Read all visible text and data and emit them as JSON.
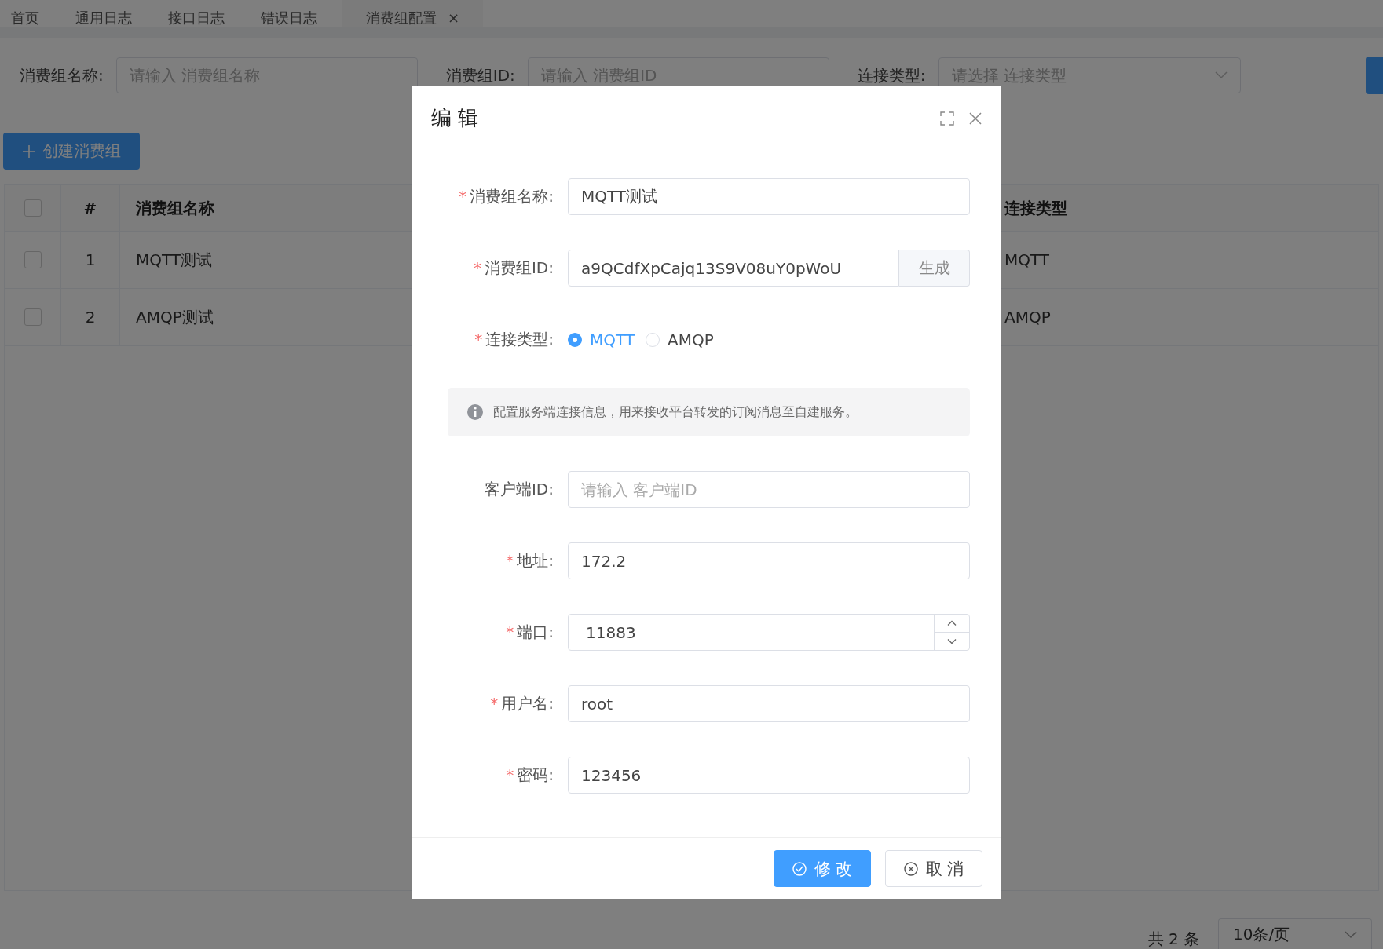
{
  "tabs": [
    {
      "label": "首页",
      "selected": false,
      "closable": false
    },
    {
      "label": "通用日志",
      "selected": false,
      "closable": false
    },
    {
      "label": "接口日志",
      "selected": false,
      "closable": false
    },
    {
      "label": "错误日志",
      "selected": false,
      "closable": false
    },
    {
      "label": "消费组配置",
      "selected": true,
      "closable": true
    }
  ],
  "tab_close": "×",
  "filters": [
    {
      "kind": "input",
      "label": "消费组名称:",
      "placeholder": "请输入 消费组名称"
    },
    {
      "kind": "input",
      "label": "消费组ID:",
      "placeholder": "请输入 消费组ID"
    },
    {
      "kind": "select",
      "label": "连接类型:",
      "placeholder": "请选择 连接类型"
    }
  ],
  "create_button": {
    "label": "创建消费组"
  },
  "table": {
    "select_all_checked": false,
    "columns": [
      "#",
      "消费组名称",
      "连接类型"
    ],
    "rows": [
      {
        "checked": false,
        "index": "1",
        "name": "MQTT测试",
        "type": "MQTT"
      },
      {
        "checked": false,
        "index": "2",
        "name": "AMQP测试",
        "type": "AMQP"
      }
    ]
  },
  "pagination": {
    "total": "共 2 条",
    "page_size": "10条/页"
  },
  "dialog": {
    "title": "编 辑",
    "required_mark": "*",
    "fields": [
      {
        "kind": "text",
        "label": "消费组名称:",
        "required": true,
        "value": "MQTT测试"
      },
      {
        "kind": "append",
        "label": "消费组ID:",
        "required": true,
        "value": "a9QCdfXpCajq13S9V08uY0pWoU",
        "append": "生成"
      },
      {
        "kind": "radio",
        "label": "连接类型:",
        "required": true,
        "options": [
          {
            "label": "MQTT",
            "selected": true
          },
          {
            "label": "AMQP",
            "selected": false
          }
        ]
      },
      {
        "kind": "alert",
        "text": "配置服务端连接信息，用来接收平台转发的订阅消息至自建服务。"
      },
      {
        "kind": "text",
        "label": "客户端ID:",
        "required": false,
        "placeholder": "请输入 客户端ID"
      },
      {
        "kind": "text",
        "label": "地址:",
        "required": true,
        "value": "172.2"
      },
      {
        "kind": "number",
        "label": "端口:",
        "required": true,
        "value": "11883"
      },
      {
        "kind": "text",
        "label": "用户名:",
        "required": true,
        "value": "root"
      },
      {
        "kind": "text",
        "label": "密码:",
        "required": true,
        "value": "123456"
      }
    ],
    "buttons": [
      {
        "kind": "primary",
        "label": "修 改"
      },
      {
        "kind": "default",
        "label": "取 消"
      }
    ]
  }
}
